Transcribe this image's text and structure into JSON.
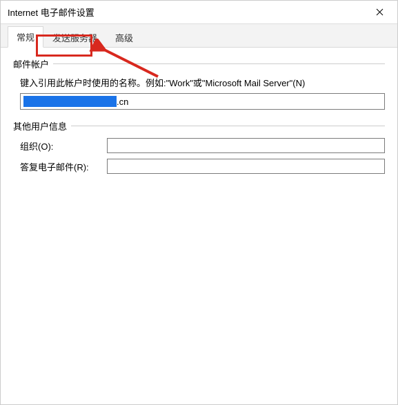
{
  "titlebar": {
    "title": "Internet 电子邮件设置"
  },
  "tabs": {
    "general": "常规",
    "outgoing": "发送服务器",
    "advanced": "高级"
  },
  "groups": {
    "mail_account": {
      "label": "邮件帐户",
      "desc": "键入引用此帐户时使用的名称。例如:\"Work\"或\"Microsoft Mail Server\"(N)",
      "value_suffix": ".cn"
    },
    "other_user_info": {
      "label": "其他用户信息",
      "org_label": "组织(O):",
      "reply_label": "答复电子邮件(R):",
      "org_value": "",
      "reply_value": ""
    }
  }
}
